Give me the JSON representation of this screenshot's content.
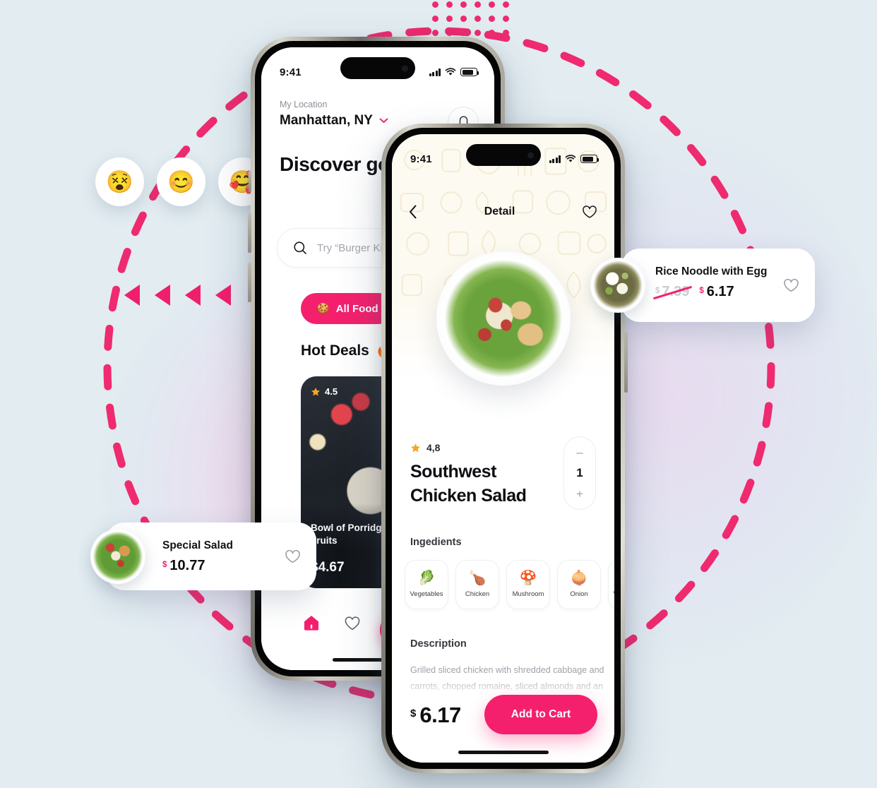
{
  "background": {
    "page_color": "#e2ecf1",
    "accent_color": "#f4206e",
    "dash_color": "#ef2a6f"
  },
  "decor": {
    "emojis": [
      {
        "name": "woozy-face",
        "glyph": "😵"
      },
      {
        "name": "smiling-face",
        "glyph": "😊"
      },
      {
        "name": "smiling-face-with-hearts",
        "glyph": "🥰"
      }
    ],
    "triangle_count": 4,
    "dot_rows": 3,
    "dot_cols": 6
  },
  "phone_home": {
    "status": {
      "time": "9:41",
      "signal_icon": "cellular-bars-icon",
      "wifi_icon": "wifi-icon",
      "battery_icon": "battery-icon"
    },
    "location": {
      "label": "My Location",
      "city": "Manhattan, NY",
      "chevron": "⌄"
    },
    "bell_icon": "notification-bell-icon",
    "headline": "Discover good food around you",
    "search": {
      "placeholder": "Try “Burger King”",
      "icon": "search-icon"
    },
    "chips": [
      {
        "label": "All Food",
        "emoji": "🍪",
        "active": true
      }
    ],
    "section": {
      "title": "Hot Deals",
      "emoji": "🔥"
    },
    "deals": [
      {
        "name": "Bowl of Porridge with Fruits",
        "rating": "4.5",
        "price": "4.67",
        "currency": "$"
      }
    ],
    "tabs": [
      {
        "name": "home",
        "icon": "home-icon",
        "active": true
      },
      {
        "name": "favorites",
        "icon": "heart-icon",
        "active": false
      },
      {
        "name": "cart",
        "icon": "cart-icon",
        "active": false
      }
    ]
  },
  "phone_detail": {
    "status": {
      "time": "9:41"
    },
    "nav": {
      "back_icon": "chevron-left-icon",
      "title": "Detail",
      "fav_icon": "heart-icon"
    },
    "product": {
      "rating": "4,8",
      "title": "Southwest Chicken Salad",
      "quantity": "1",
      "minus": "–",
      "plus": "+",
      "price": "6.17",
      "currency": "$"
    },
    "ingredients_heading": "Ingedients",
    "ingredients": [
      {
        "label": "Vegetables",
        "emoji": "🥬"
      },
      {
        "label": "Chicken",
        "emoji": "🍗"
      },
      {
        "label": "Mushroom",
        "emoji": "🍄"
      },
      {
        "label": "Onion",
        "emoji": "🧅"
      },
      {
        "label": "Vegetables",
        "emoji": "🍄"
      }
    ],
    "description_heading": "Description",
    "description": "Grilled sliced chicken with shredded cabbage and carrots, chopped romaine, sliced almonds and an Asian sesame vinaigrette.",
    "cta_label": "Add to Cart"
  },
  "floating_cards": [
    {
      "id": "special-salad",
      "title": "Special Salad",
      "currency": "$",
      "price": "10.77",
      "old_price": null,
      "fav_icon": "heart-icon"
    },
    {
      "id": "rice-noodle",
      "title": "Rice Noodle with Egg",
      "currency": "$",
      "price": "6.17",
      "old_price": "7.39",
      "fav_icon": "heart-icon"
    }
  ]
}
